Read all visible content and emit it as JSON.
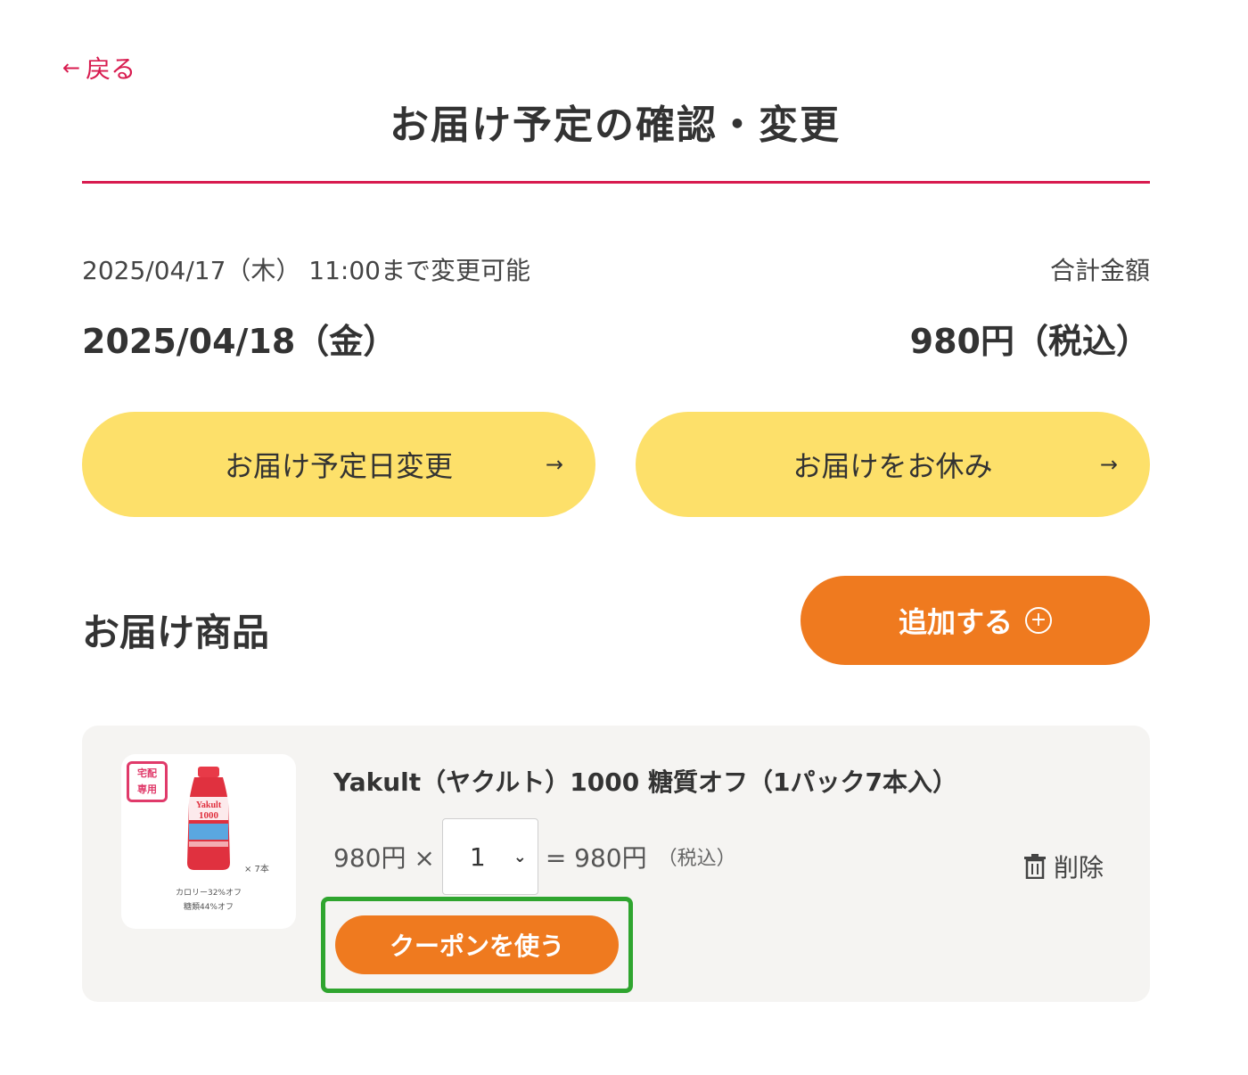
{
  "header": {
    "back_arrow": "←",
    "back_label": "戻る",
    "title": "お届け予定の確認・変更"
  },
  "summary": {
    "deadline": "2025/04/17（木） 11:00まで変更可能",
    "total_label": "合計金額",
    "delivery_date": "2025/04/18（金）",
    "total_amount": "980円（税込）"
  },
  "actions": {
    "change_date_label": "お届け予定日変更",
    "skip_label": "お届けをお休み",
    "arrow": "→"
  },
  "products_section": {
    "title": "お届け商品",
    "add_label": "追加する",
    "add_icon": "+"
  },
  "product": {
    "tag_line1": "宅配",
    "tag_line2": "専用",
    "count_text": "× 7本",
    "caption1": "カロリー32%オフ",
    "caption2": "糖類44%オフ",
    "bottle_brand": "Yakult",
    "bottle_number": "1000",
    "name": "Yakult（ヤクルト）1000 糖質オフ（1パック7本入）",
    "unit_price": "980円 ×",
    "quantity": "1",
    "subtotal": "= 980円",
    "tax_note": "（税込）",
    "delete_label": "削除",
    "coupon_label": "クーポンを使う"
  },
  "colors": {
    "accent_red": "#d81b4f",
    "yellow_button": "#fde06a",
    "orange_button": "#ef7a1f",
    "highlight_green": "#2fa52f",
    "card_bg": "#f5f4f2"
  }
}
